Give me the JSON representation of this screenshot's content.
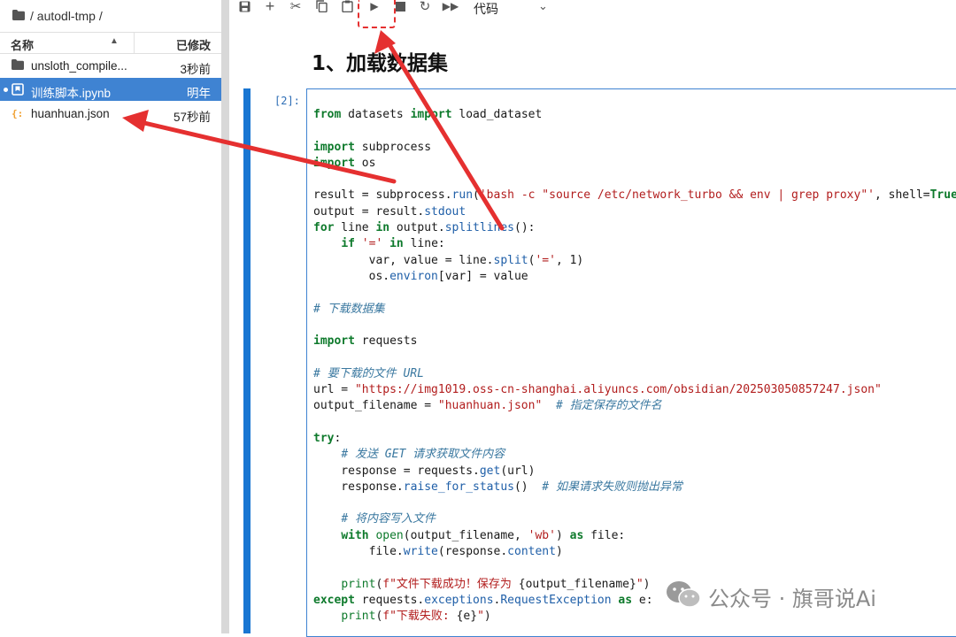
{
  "browser": {
    "path": "/ autodl-tmp /",
    "columns": {
      "name": "名称",
      "modified": "已修改"
    },
    "files": [
      {
        "name": "unsloth_compile...",
        "modified": "3秒前",
        "icon": "folder-icon",
        "selected": false
      },
      {
        "name": "训练脚本.ipynb",
        "modified": "明年",
        "icon": "notebook-icon",
        "selected": true
      },
      {
        "name": "huanhuan.json",
        "modified": "57秒前",
        "icon": "json-icon",
        "selected": false
      }
    ]
  },
  "toolbar": {
    "icons": [
      "save-icon",
      "add-cell-icon",
      "cut-icon",
      "copy-icon",
      "paste-icon",
      "run-icon",
      "stop-icon",
      "restart-icon",
      "run-all-icon"
    ],
    "cell_type": "代码"
  },
  "notebook": {
    "heading": "1、加载数据集",
    "prompt": "[2]:"
  },
  "watermark": {
    "text": "公众号 · 旗哥说Ai",
    "icon": "wechat-icon"
  },
  "colors": {
    "accent": "#3f83d2",
    "arrow": "#e53030",
    "active_bar": "#1976d2"
  }
}
